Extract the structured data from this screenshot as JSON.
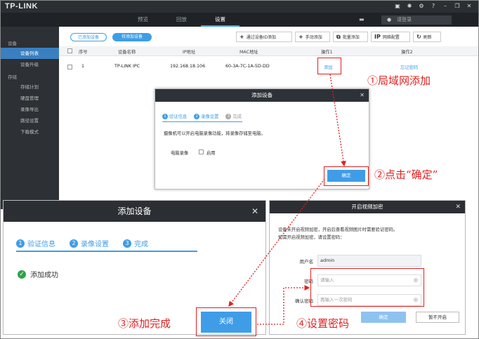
{
  "app": {
    "logo": "TP-LINK",
    "login": "请登录"
  },
  "nav": {
    "tabs": [
      "预览",
      "回放",
      "设置"
    ],
    "active": 2
  },
  "sidebar": {
    "groups": [
      {
        "label": "设备",
        "items": [
          "设备列表",
          "设备升级"
        ]
      },
      {
        "label": "存储",
        "items": [
          "存储计划",
          "硬盘管理",
          "录像导出",
          "路径设置",
          "下载模式"
        ]
      }
    ],
    "active_item": "设备列表"
  },
  "toolbar": {
    "added": "已添加设备",
    "pending": "待添加设备",
    "add_by_id": "通过设备ID添加",
    "manual_add": "手动添加",
    "batch_add": "批量添加",
    "ip_config": "网络配置",
    "refresh": "刷新"
  },
  "table": {
    "headers": [
      "序号",
      "设备名称",
      "IP地址",
      "MAC地址",
      "操作1",
      "操作2"
    ],
    "rows": [
      {
        "index": "1",
        "name": "TP-LINK IPC",
        "ip": "192.168.18.106",
        "mac": "60-3A-7C-1A-5D-DD",
        "op1": "添加",
        "op2": "忘记密码"
      }
    ]
  },
  "dialog_record": {
    "title": "添加设备",
    "steps": [
      "验证信息",
      "录像设置",
      "完成"
    ],
    "description": "摄像机可以开启电脑录像功能，将录像存储至电脑。",
    "record_label": "电脑录像",
    "enable_label": "启用",
    "ok": "确定"
  },
  "dialog_done": {
    "title": "添加设备",
    "steps": [
      "验证信息",
      "录像设置",
      "完成"
    ],
    "success": "添加成功",
    "close": "关闭"
  },
  "dialog_encrypt": {
    "title": "开启视频加密",
    "desc_line1": "设备未开启视频加密，开启后查看视频图片时需要验证密码。",
    "desc_line2": "如需开启视频加密，请设置密码：",
    "username_label": "用户名",
    "username_value": "admin",
    "password_label": "密码",
    "password_placeholder": "请输入",
    "confirm_label": "确认密码",
    "confirm_placeholder": "再输入一次密码",
    "ok": "确定",
    "skip": "暂不开启"
  },
  "annotations": {
    "step1": "①局域网添加",
    "step2": "②点击“确定”",
    "step3": "③添加完成",
    "step4": "④设置密码",
    "color": "#e02020"
  }
}
